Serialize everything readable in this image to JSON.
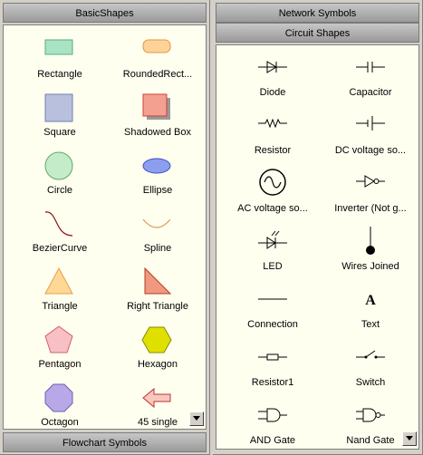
{
  "left_panel": {
    "header": "BasicShapes",
    "footer": "Flowchart Symbols",
    "items": [
      {
        "label": "Rectangle",
        "icon": "rectangle-icon"
      },
      {
        "label": "RoundedRect...",
        "icon": "rounded-rect-icon"
      },
      {
        "label": "Square",
        "icon": "square-icon"
      },
      {
        "label": "Shadowed Box",
        "icon": "shadowed-box-icon"
      },
      {
        "label": "Circle",
        "icon": "circle-icon"
      },
      {
        "label": "Ellipse",
        "icon": "ellipse-icon"
      },
      {
        "label": "BezierCurve",
        "icon": "bezier-curve-icon"
      },
      {
        "label": "Spline",
        "icon": "spline-icon"
      },
      {
        "label": "Triangle",
        "icon": "triangle-icon"
      },
      {
        "label": "Right Triangle",
        "icon": "right-triangle-icon"
      },
      {
        "label": "Pentagon",
        "icon": "pentagon-icon"
      },
      {
        "label": "Hexagon",
        "icon": "hexagon-icon"
      },
      {
        "label": "Octagon",
        "icon": "octagon-icon"
      },
      {
        "label": "45 single",
        "icon": "arrow-left-icon"
      }
    ]
  },
  "right_panel": {
    "header_top": "Network Symbols",
    "header": "Circuit Shapes",
    "items": [
      {
        "label": "Diode",
        "icon": "diode-icon"
      },
      {
        "label": "Capacitor",
        "icon": "capacitor-icon"
      },
      {
        "label": "Resistor",
        "icon": "resistor-icon"
      },
      {
        "label": "DC voltage so...",
        "icon": "dc-voltage-icon"
      },
      {
        "label": "AC voltage so...",
        "icon": "ac-voltage-icon"
      },
      {
        "label": "Inverter (Not g...",
        "icon": "inverter-icon"
      },
      {
        "label": "LED",
        "icon": "led-icon"
      },
      {
        "label": "Wires Joined",
        "icon": "wires-joined-icon"
      },
      {
        "label": "Connection",
        "icon": "connection-icon"
      },
      {
        "label": "Text",
        "icon": "text-icon"
      },
      {
        "label": "Resistor1",
        "icon": "resistor1-icon"
      },
      {
        "label": "Switch",
        "icon": "switch-icon"
      },
      {
        "label": "AND Gate",
        "icon": "and-gate-icon"
      },
      {
        "label": "Nand Gate",
        "icon": "nand-gate-icon"
      }
    ]
  },
  "text_icon_glyph": "A"
}
